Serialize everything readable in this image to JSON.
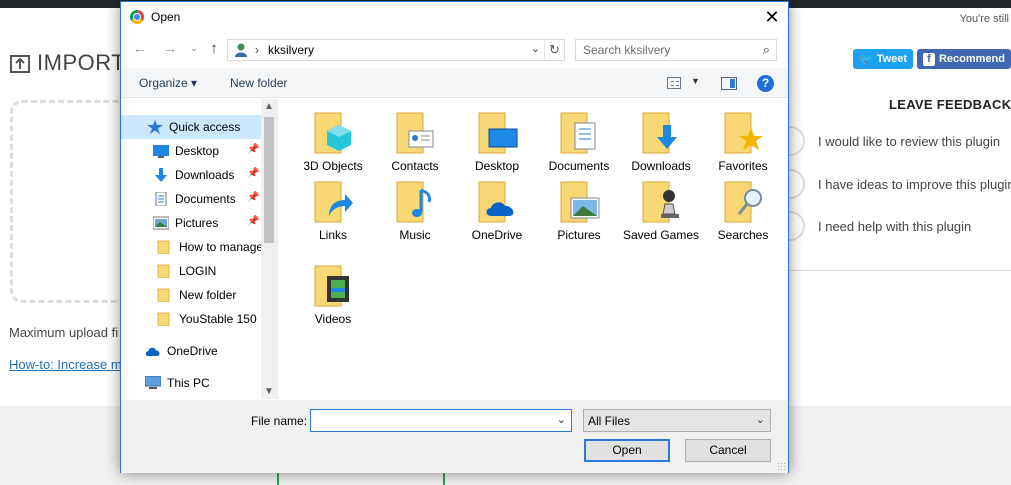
{
  "background_page": {
    "notice_text": "You're still",
    "import_title": "IMPORT",
    "max_upload_text": "Maximum upload fi",
    "howto_link": "How-to: Increase m",
    "share": {
      "tweet_label": "Tweet",
      "recommend_label": "Recommend"
    },
    "feedback": {
      "title": "LEAVE FEEDBACK",
      "options": [
        "I would like to review this plugin",
        "I have ideas to improve this plugin",
        "I need help with this plugin"
      ]
    }
  },
  "dialog": {
    "title": "Open",
    "address": {
      "separator": "›",
      "path": "kksilvery"
    },
    "search": {
      "placeholder": "Search kksilvery"
    },
    "commands": {
      "organize": "Organize ▾",
      "new_folder": "New folder",
      "help": "?"
    },
    "nav_pane": [
      {
        "label": "Quick access",
        "icon": "star-icon"
      },
      {
        "label": "Desktop",
        "icon": "desktop-icon"
      },
      {
        "label": "Downloads",
        "icon": "download-arrow-icon"
      },
      {
        "label": "Documents",
        "icon": "document-icon"
      },
      {
        "label": "Pictures",
        "icon": "pictures-icon"
      },
      {
        "label": "How to manage",
        "icon": "folder-icon"
      },
      {
        "label": "LOGIN",
        "icon": "folder-icon"
      },
      {
        "label": "New folder",
        "icon": "folder-icon"
      },
      {
        "label": "YouStable 150",
        "icon": "folder-icon"
      },
      {
        "label": "OneDrive",
        "icon": "cloud-icon"
      },
      {
        "label": "This PC",
        "icon": "computer-icon"
      }
    ],
    "items": [
      {
        "label": "3D Objects",
        "icon": "3d-objects-folder-icon"
      },
      {
        "label": "Contacts",
        "icon": "contacts-folder-icon"
      },
      {
        "label": "Desktop",
        "icon": "desktop-folder-icon"
      },
      {
        "label": "Documents",
        "icon": "documents-folder-icon"
      },
      {
        "label": "Downloads",
        "icon": "downloads-folder-icon"
      },
      {
        "label": "Favorites",
        "icon": "favorites-folder-icon"
      },
      {
        "label": "Links",
        "icon": "links-folder-icon"
      },
      {
        "label": "Music",
        "icon": "music-folder-icon"
      },
      {
        "label": "OneDrive",
        "icon": "onedrive-folder-icon"
      },
      {
        "label": "Pictures",
        "icon": "pictures-folder-icon"
      },
      {
        "label": "Saved Games",
        "icon": "saved-games-folder-icon"
      },
      {
        "label": "Searches",
        "icon": "searches-folder-icon"
      },
      {
        "label": "Videos",
        "icon": "videos-folder-icon"
      }
    ],
    "file_name_label": "File name:",
    "file_name_value": "",
    "file_type_value": "All Files",
    "open_label": "Open",
    "cancel_label": "Cancel"
  },
  "colors": {
    "accent": "#2b78d6",
    "selection": "#cce8ff",
    "folder": "#f8d775",
    "link": "#2271b1"
  }
}
